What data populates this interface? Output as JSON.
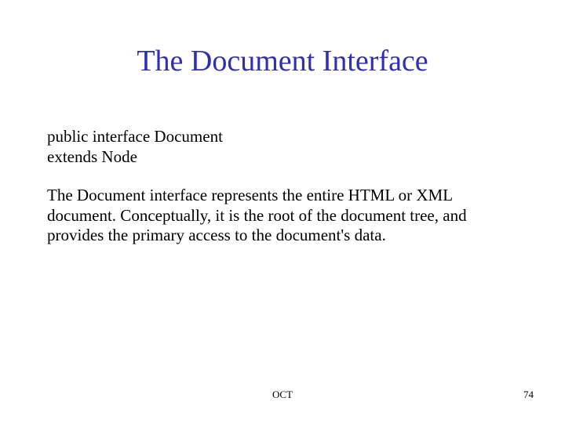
{
  "title": "The Document Interface",
  "decl_line1": "public interface Document",
  "decl_line2": "extends Node",
  "description": "The Document interface represents the entire HTML or XML document. Conceptually, it is the root of the document tree, and provides the primary access to the document's data.",
  "footer_center": "OCT",
  "footer_page": "74"
}
